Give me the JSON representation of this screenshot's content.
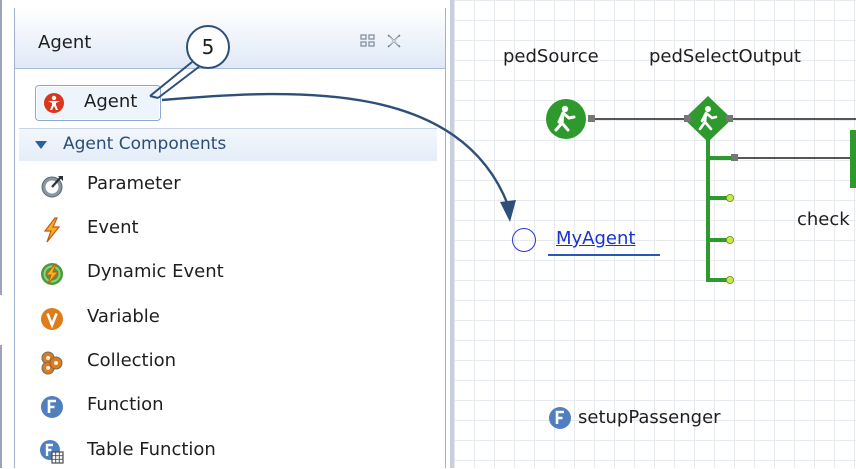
{
  "palette": {
    "title": "Agent",
    "agent_item": {
      "label": "Agent",
      "icon": "agent-icon"
    },
    "section": {
      "label": "Agent Components"
    },
    "items": [
      {
        "label": "Parameter",
        "icon": "parameter-icon"
      },
      {
        "label": "Event",
        "icon": "event-icon"
      },
      {
        "label": "Dynamic Event",
        "icon": "dynamic-event-icon"
      },
      {
        "label": "Variable",
        "icon": "variable-icon"
      },
      {
        "label": "Collection",
        "icon": "collection-icon"
      },
      {
        "label": "Function",
        "icon": "function-icon"
      },
      {
        "label": "Table Function",
        "icon": "table-function-icon"
      }
    ]
  },
  "callout": {
    "number": "5"
  },
  "canvas": {
    "ped_source_label": "pedSource",
    "ped_select_output_label": "pedSelectOutput",
    "check_label": "check",
    "my_agent_label": "MyAgent",
    "setup_function_label": "setupPassenger"
  },
  "colors": {
    "flow_green": "#2e9a2e",
    "connector_gray": "#6f6f6f",
    "port_yellow": "#c9e84a",
    "arrow_blue": "#2d4f78",
    "link_blue": "#1a33cc"
  }
}
